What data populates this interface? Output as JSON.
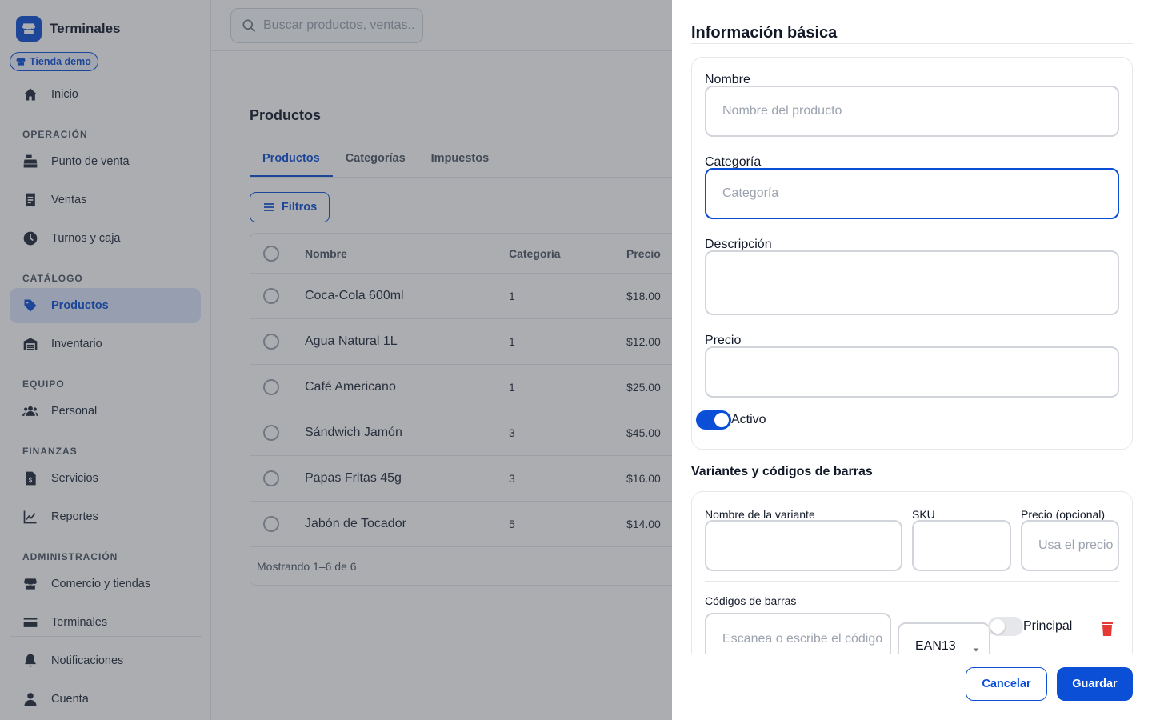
{
  "app": {
    "name": "Terminales",
    "store": "Tienda demo"
  },
  "search": {
    "placeholder": "Buscar productos, ventas..."
  },
  "sidebar": {
    "home": "Inicio",
    "sections": {
      "operacion": "OPERACIÓN",
      "catalogo": "CATÁLOGO",
      "equipo": "EQUIPO",
      "finanzas": "FINANZAS",
      "administracion": "ADMINISTRACIÓN"
    },
    "items": {
      "pos": "Punto de venta",
      "ventas": "Ventas",
      "turnos": "Turnos y caja",
      "productos": "Productos",
      "inventario": "Inventario",
      "personal": "Personal",
      "servicios": "Servicios",
      "reportes": "Reportes",
      "comercio": "Comercio y tiendas",
      "terminales": "Terminales",
      "notificaciones": "Notificaciones",
      "cuenta": "Cuenta"
    }
  },
  "main": {
    "title": "Productos",
    "tabs": [
      "Productos",
      "Categorías",
      "Impuestos"
    ],
    "filters_label": "Filtros",
    "table": {
      "headers": {
        "name": "Nombre",
        "category": "Categoría",
        "price": "Precio"
      },
      "rows": [
        {
          "name": "Coca-Cola 600ml",
          "category": "1",
          "price": "$18.00"
        },
        {
          "name": "Agua Natural 1L",
          "category": "1",
          "price": "$12.00"
        },
        {
          "name": "Café Americano",
          "category": "1",
          "price": "$25.00"
        },
        {
          "name": "Sándwich Jamón",
          "category": "3",
          "price": "$45.00"
        },
        {
          "name": "Papas Fritas 45g",
          "category": "3",
          "price": "$16.00"
        },
        {
          "name": "Jabón de Tocador",
          "category": "5",
          "price": "$14.00"
        }
      ],
      "footer": "Mostrando 1–6 de 6"
    }
  },
  "drawer": {
    "basic_title": "Información básica",
    "name_label": "Nombre",
    "name_placeholder": "Nombre del producto",
    "category_label": "Categoría",
    "category_placeholder": "Categoría",
    "description_label": "Descripción",
    "price_label": "Precio",
    "active_label": "Activo",
    "variants_title": "Variantes y códigos de barras",
    "variant_name_label": "Nombre de la variante",
    "sku_label": "SKU",
    "variant_price_label": "Precio (opcional)",
    "variant_price_placeholder": "Usa el precio base",
    "barcodes_label": "Códigos de barras",
    "barcode_placeholder": "Escanea o escribe el código",
    "barcode_type": "EAN13",
    "principal_label": "Principal",
    "cancel": "Cancelar",
    "save": "Guardar"
  },
  "colors": {
    "accent": "#0b4fd6",
    "danger": "#e53935"
  }
}
